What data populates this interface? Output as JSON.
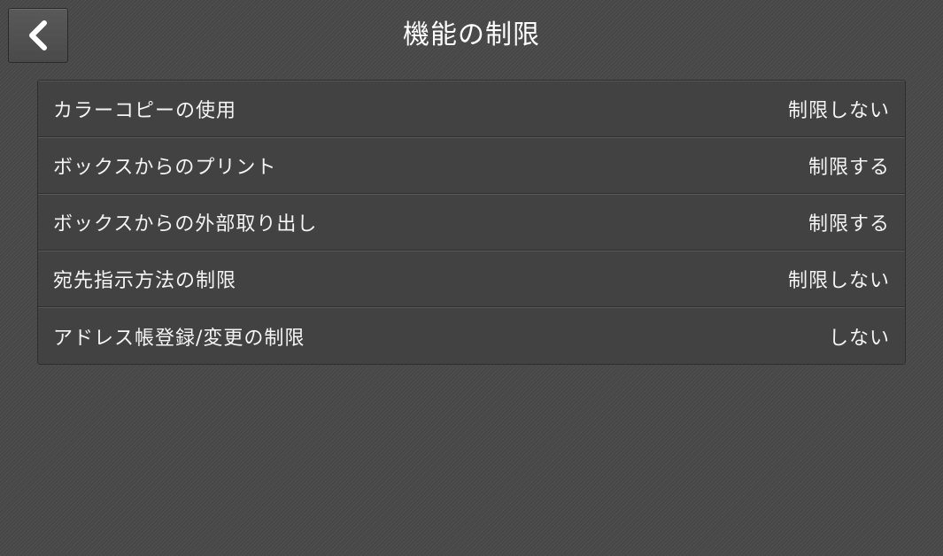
{
  "header": {
    "title": "機能の制限",
    "back_icon": "chevron-left-icon"
  },
  "settings": {
    "items": [
      {
        "label": "カラーコピーの使用",
        "value": "制限しない"
      },
      {
        "label": "ボックスからのプリント",
        "value": "制限する"
      },
      {
        "label": "ボックスからの外部取り出し",
        "value": "制限する"
      },
      {
        "label": "宛先指示方法の制限",
        "value": "制限しない"
      },
      {
        "label": "アドレス帳登録/変更の制限",
        "value": "しない"
      }
    ]
  },
  "colors": {
    "background": "#474747",
    "row_background": "#424242",
    "text": "#f4f4f4"
  }
}
